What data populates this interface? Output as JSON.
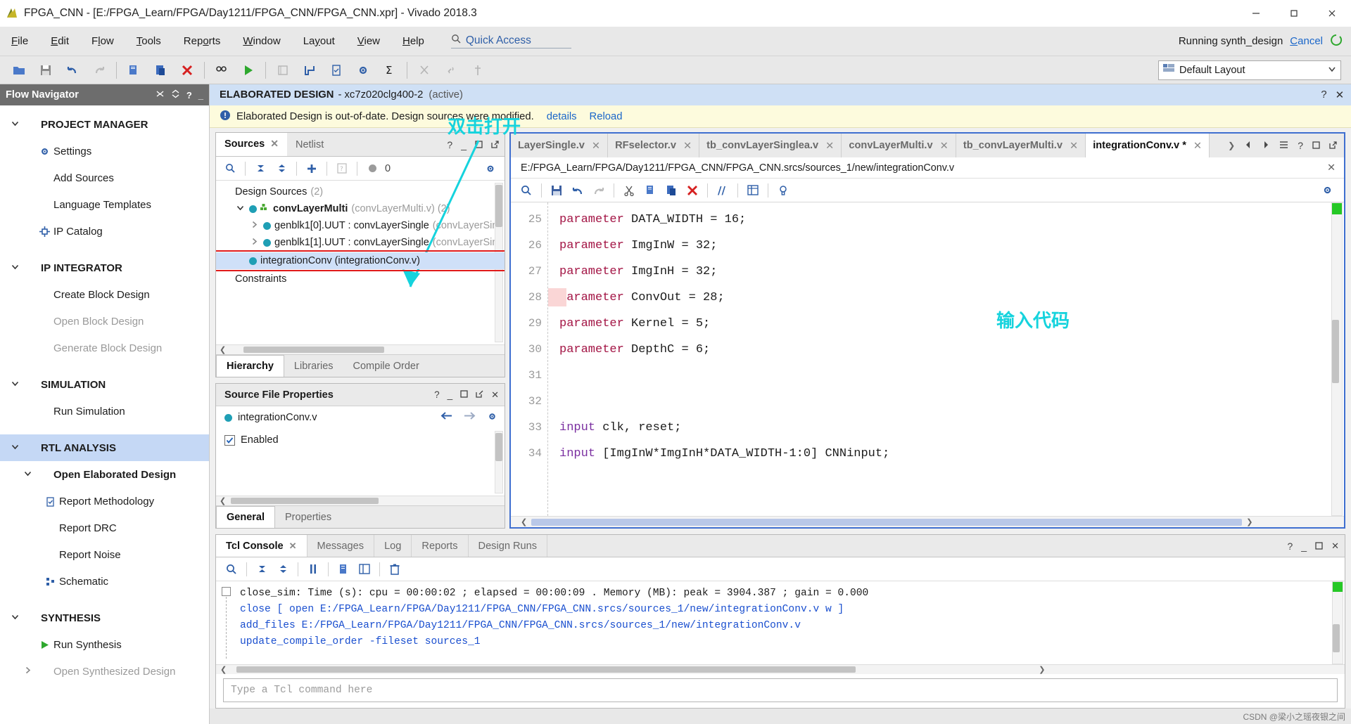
{
  "window": {
    "title": "FPGA_CNN - [E:/FPGA_Learn/FPGA/Day1211/FPGA_CNN/FPGA_CNN.xpr] - Vivado 2018.3",
    "minimize": "minimize-icon",
    "maximize": "maximize-icon",
    "close": "close-icon"
  },
  "menubar": {
    "items": [
      {
        "label": "File",
        "mnemonic": "F"
      },
      {
        "label": "Edit",
        "mnemonic": "E"
      },
      {
        "label": "Flow",
        "mnemonic": "l"
      },
      {
        "label": "Tools",
        "mnemonic": "T"
      },
      {
        "label": "Reports",
        "mnemonic": "o"
      },
      {
        "label": "Window",
        "mnemonic": "W"
      },
      {
        "label": "Layout",
        "mnemonic": "y"
      },
      {
        "label": "View",
        "mnemonic": "V"
      },
      {
        "label": "Help",
        "mnemonic": "H"
      }
    ],
    "quick_access": "Quick Access",
    "run_status": "Running synth_design",
    "cancel_label": "Cancel"
  },
  "toolbar": {
    "layout_label": "Default Layout",
    "buttons": [
      "open-project-icon",
      "save-icon",
      "undo-icon",
      "redo-icon",
      "copy-icon",
      "paste-icon",
      "delete-icon",
      "search-replace-icon",
      "run-icon",
      "report-icon",
      "flow-icon",
      "checklist-icon",
      "settings-icon",
      "sum-icon",
      "cut-tool-icon",
      "link-icon",
      "marker-icon"
    ]
  },
  "flow_navigator": {
    "title": "Flow Navigator",
    "header_icons": [
      "collapse-all-icon",
      "expand-all-icon",
      "help-icon",
      "minimize-icon"
    ],
    "items": [
      {
        "label": "PROJECT MANAGER",
        "level": 0,
        "kind": "section",
        "arrow": "chevron-down",
        "bold": true
      },
      {
        "label": "Settings",
        "level": 1,
        "icon": "gear-icon"
      },
      {
        "label": "Add Sources",
        "level": 1
      },
      {
        "label": "Language Templates",
        "level": 1
      },
      {
        "label": "IP Catalog",
        "level": 1,
        "icon": "ip-catalog-icon"
      },
      {
        "label": "IP INTEGRATOR",
        "level": 0,
        "kind": "section",
        "arrow": "chevron-down"
      },
      {
        "label": "Create Block Design",
        "level": 1
      },
      {
        "label": "Open Block Design",
        "level": 1,
        "disabled": true
      },
      {
        "label": "Generate Block Design",
        "level": 1,
        "disabled": true
      },
      {
        "label": "SIMULATION",
        "level": 0,
        "kind": "section",
        "arrow": "chevron-down"
      },
      {
        "label": "Run Simulation",
        "level": 1
      },
      {
        "label": "RTL ANALYSIS",
        "level": 0,
        "kind": "section",
        "arrow": "chevron-down",
        "selected": true,
        "bold": true
      },
      {
        "label": "Open Elaborated Design",
        "level": 1,
        "arrow": "chevron-down",
        "bold": true
      },
      {
        "label": "Report Methodology",
        "level": 2,
        "icon": "clipboard-check-icon"
      },
      {
        "label": "Report DRC",
        "level": 2
      },
      {
        "label": "Report Noise",
        "level": 2
      },
      {
        "label": "Schematic",
        "level": 2,
        "icon": "schematic-icon"
      },
      {
        "label": "SYNTHESIS",
        "level": 0,
        "kind": "section",
        "arrow": "chevron-down"
      },
      {
        "label": "Run Synthesis",
        "level": 1,
        "icon": "play-icon"
      },
      {
        "label": "Open Synthesized Design",
        "level": 1,
        "arrow": "chevron-right",
        "disabled": true
      }
    ]
  },
  "design_header": {
    "title": "ELABORATED DESIGN",
    "part": "- xc7z020clg400-2",
    "state": "(active)",
    "icons": [
      "help-icon",
      "close-icon"
    ]
  },
  "warning_bar": {
    "icon": "info-icon",
    "text": "Elaborated Design is out-of-date. Design sources were modified.",
    "details_link": "details",
    "reload_link": "Reload"
  },
  "sources_panel": {
    "tabs": [
      {
        "label": "Sources",
        "active": true,
        "closable": true
      },
      {
        "label": "Netlist",
        "active": false
      }
    ],
    "header_icons": [
      "help-icon",
      "minimize-icon",
      "maximize-icon",
      "float-icon"
    ],
    "toolbar_icons": [
      "search-icon",
      "collapse-all-icon",
      "expand-all-icon",
      "add-sources-icon",
      "report-icon",
      "status-dot-icon"
    ],
    "status_count": "0",
    "gear_icon": "gear-icon",
    "tree": [
      {
        "label": "Design Sources",
        "suffix": "(2)",
        "indent": 0,
        "expander": ""
      },
      {
        "label": "convLayerMulti",
        "suffix": "(convLayerMulti.v) (2)",
        "indent": 1,
        "expander": "chevron-down",
        "bold": true,
        "dot": true,
        "module_icon": true
      },
      {
        "label": "genblk1[0].UUT : convLayerSingle",
        "suffix": "(convLayerSing",
        "indent": 2,
        "expander": "chevron-right",
        "dot": true
      },
      {
        "label": "genblk1[1].UUT : convLayerSingle",
        "suffix": "(convLayerSing",
        "indent": 2,
        "expander": "chevron-right",
        "dot": true
      },
      {
        "label": "integrationConv (integrationConv.v)",
        "suffix": "",
        "indent": 1,
        "expander": "",
        "dot": true,
        "selected": true,
        "highlight_box": true
      },
      {
        "label": "Constraints",
        "suffix": "",
        "indent": 0,
        "expander": ""
      }
    ],
    "bottom_tabs": [
      {
        "label": "Hierarchy",
        "active": true
      },
      {
        "label": "Libraries",
        "active": false
      },
      {
        "label": "Compile Order",
        "active": false
      }
    ]
  },
  "source_file_properties": {
    "title": "Source File Properties",
    "header_icons": [
      "help-icon",
      "minimize-icon",
      "maximize-icon",
      "float-icon",
      "close-icon"
    ],
    "file_name": "integrationConv.v",
    "nav_icons": [
      "back-arrow-icon",
      "forward-arrow-icon",
      "gear-icon"
    ],
    "enabled_label": "Enabled",
    "enabled_checked": true,
    "tabs": [
      {
        "label": "General",
        "active": true
      },
      {
        "label": "Properties",
        "active": false
      }
    ]
  },
  "editor": {
    "tabs": [
      {
        "label": "LayerSingle.v",
        "active": false,
        "closable": true
      },
      {
        "label": "RFselector.v",
        "active": false,
        "closable": true
      },
      {
        "label": "tb_convLayerSinglea.v",
        "active": false,
        "closable": true
      },
      {
        "label": "convLayerMulti.v",
        "active": false,
        "closable": true
      },
      {
        "label": "tb_convLayerMulti.v",
        "active": false,
        "closable": true
      },
      {
        "label": "integrationConv.v *",
        "active": true,
        "closable": true
      }
    ],
    "tab_nav_icons": [
      "chevron-right-icon",
      "prev-icon",
      "next-icon",
      "list-icon",
      "help-icon",
      "maximize-icon",
      "float-icon"
    ],
    "file_path": "E:/FPGA_Learn/FPGA/Day1211/FPGA_CNN/FPGA_CNN.srcs/sources_1/new/integrationConv.v",
    "close_icon": "close-icon",
    "toolbar_icons": [
      "search-icon",
      "save-icon",
      "undo-icon",
      "redo-icon",
      "cut-icon",
      "copy-icon",
      "paste-icon",
      "delete-icon",
      "comment-icon",
      "columns-icon",
      "bulb-icon"
    ],
    "gear_icon": "gear-icon",
    "first_line_number": 25,
    "lines": [
      {
        "n": 25,
        "tokens": [
          {
            "t": "parameter",
            "c": "kw"
          },
          {
            "t": " DATA_WIDTH = 16;",
            "c": ""
          }
        ]
      },
      {
        "n": 26,
        "tokens": [
          {
            "t": "parameter",
            "c": "kw"
          },
          {
            "t": " ImgInW = 32;",
            "c": ""
          }
        ]
      },
      {
        "n": 27,
        "tokens": [
          {
            "t": "parameter",
            "c": "kw"
          },
          {
            "t": " ImgInH = 32;",
            "c": ""
          }
        ]
      },
      {
        "n": 28,
        "tokens": [
          {
            "t": "parameter",
            "c": "kw"
          },
          {
            "t": " ConvOut = 28;",
            "c": ""
          }
        ],
        "marker": true
      },
      {
        "n": 29,
        "tokens": [
          {
            "t": "parameter",
            "c": "kw"
          },
          {
            "t": " Kernel = 5;",
            "c": ""
          }
        ]
      },
      {
        "n": 30,
        "tokens": [
          {
            "t": "parameter",
            "c": "kw"
          },
          {
            "t": " DepthC = 6;",
            "c": ""
          }
        ]
      },
      {
        "n": 31,
        "tokens": []
      },
      {
        "n": 32,
        "tokens": []
      },
      {
        "n": 33,
        "tokens": [
          {
            "t": "input",
            "c": "kw2"
          },
          {
            "t": " clk, reset;",
            "c": ""
          }
        ]
      },
      {
        "n": 34,
        "tokens": [
          {
            "t": "input",
            "c": "kw2"
          },
          {
            "t": " [ImgInW*ImgInH*DATA_WIDTH-1:0] CNNinput;",
            "c": ""
          }
        ]
      }
    ],
    "watermark": "输入代码"
  },
  "annotations": {
    "open_hint": "双击打开",
    "arrow_color": "#15d3dd",
    "highlight_box_color": "#e01b1b"
  },
  "console": {
    "tabs": [
      {
        "label": "Tcl Console",
        "active": true,
        "closable": true
      },
      {
        "label": "Messages",
        "active": false
      },
      {
        "label": "Log",
        "active": false
      },
      {
        "label": "Reports",
        "active": false
      },
      {
        "label": "Design Runs",
        "active": false
      }
    ],
    "header_icons": [
      "help-icon",
      "minimize-icon",
      "maximize-icon",
      "close-icon"
    ],
    "toolbar_icons": [
      "search-icon",
      "collapse-all-icon",
      "expand-all-icon",
      "pause-icon",
      "copy-icon",
      "columns-icon",
      "trash-icon"
    ],
    "lines": [
      {
        "text": "close_sim: Time (s): cpu = 00:00:02 ; elapsed = 00:00:09 . Memory (MB): peak = 3904.387 ; gain = 0.000",
        "color": "black"
      },
      {
        "text": "close [ open E:/FPGA_Learn/FPGA/Day1211/FPGA_CNN/FPGA_CNN.srcs/sources_1/new/integrationConv.v w ]",
        "color": "blue"
      },
      {
        "text": "add_files E:/FPGA_Learn/FPGA/Day1211/FPGA_CNN/FPGA_CNN.srcs/sources_1/new/integrationConv.v",
        "color": "blue"
      },
      {
        "text": "update_compile_order -fileset sources_1",
        "color": "blue"
      }
    ],
    "input_placeholder": "Type a Tcl command here"
  },
  "statusbar": {
    "watermark": "CSDN @梁小之瑶夜银之间"
  }
}
